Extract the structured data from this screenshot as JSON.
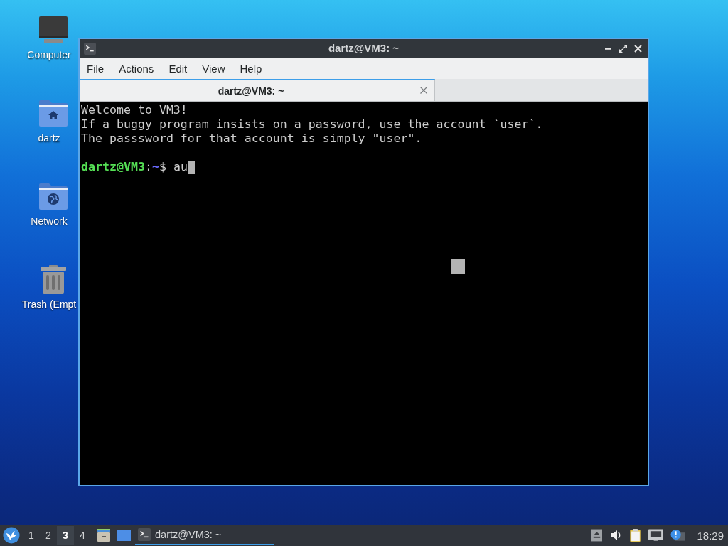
{
  "desktop_icons": [
    {
      "kind": "computer",
      "label": "Computer"
    },
    {
      "kind": "home",
      "label": "dartz"
    },
    {
      "kind": "network",
      "label": "Network"
    },
    {
      "kind": "trash",
      "label": "Trash (Empt"
    }
  ],
  "window": {
    "title": "dartz@VM3: ~",
    "menu": [
      "File",
      "Actions",
      "Edit",
      "View",
      "Help"
    ],
    "tabs": [
      {
        "label": "dartz@VM3: ~",
        "selected": true
      }
    ],
    "terminal": {
      "lines": [
        "Welcome to VM3!",
        "If a buggy program insists on a password, use the account `user`.",
        "The passsword for that account is simply \"user\"."
      ],
      "prompt": {
        "user_host": "dartz@VM3",
        "separator": ":",
        "path": "~",
        "symbol": "$",
        "input": "au"
      }
    }
  },
  "taskbar": {
    "workspaces": [
      {
        "label": "1",
        "selected": false
      },
      {
        "label": "2",
        "selected": false
      },
      {
        "label": "3",
        "selected": true
      },
      {
        "label": "4",
        "selected": false
      }
    ],
    "tasks": [
      {
        "label": "dartz@VM3: ~",
        "selected": true
      }
    ],
    "clock": "18:29"
  }
}
